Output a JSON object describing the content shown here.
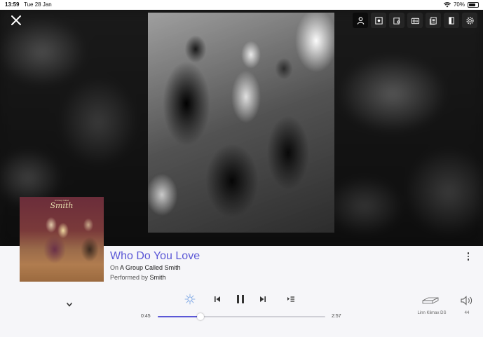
{
  "status_bar": {
    "time": "13:59",
    "date": "Tue 28 Jan",
    "battery": "70%",
    "battery_level": 0.7
  },
  "toolbar": {
    "buttons": [
      "person-icon",
      "record-icon",
      "notes-icon",
      "info-card-icon",
      "credits-icon",
      "book-icon",
      "gear-icon"
    ],
    "active": "person-icon"
  },
  "album_art": {
    "logo_text": "Smith",
    "pre_text": "A Group Called"
  },
  "track": {
    "title": "Who Do You Love",
    "on_prefix": "On",
    "album": "A Group Called Smith",
    "performed_prefix": "Performed by",
    "artist": "Smith"
  },
  "playback": {
    "elapsed": "0:45",
    "duration": "2:57",
    "progress": 0.254
  },
  "output": {
    "device": "Linn Klimax DS",
    "volume": "44"
  },
  "colors": {
    "accent": "#5b57d6",
    "background": "#f6f6f9"
  }
}
